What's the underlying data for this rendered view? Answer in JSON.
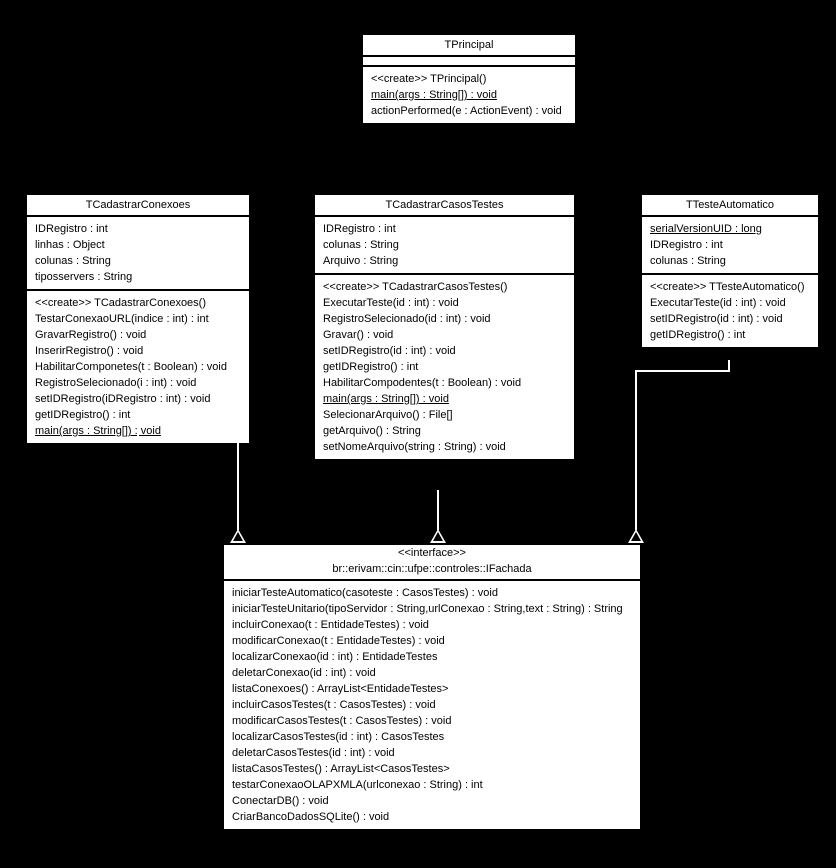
{
  "classes": {
    "tprincipal": {
      "name": "TPrincipal",
      "attrs": [],
      "methods": [
        {
          "text": "<<create>> TPrincipal()",
          "static": false
        },
        {
          "text": "main(args : String[]) : void",
          "static": true
        },
        {
          "text": "actionPerformed(e : ActionEvent) : void",
          "static": false
        }
      ]
    },
    "tcadconexoes": {
      "name": "TCadastrarConexoes",
      "attrs": [
        {
          "text": "IDRegistro : int"
        },
        {
          "text": "linhas : Object"
        },
        {
          "text": "colunas : String"
        },
        {
          "text": "tiposservers : String"
        }
      ],
      "methods": [
        {
          "text": "<<create>> TCadastrarConexoes()",
          "static": false
        },
        {
          "text": "TestarConexaoURL(indice : int) : int",
          "static": false
        },
        {
          "text": "GravarRegistro() : void",
          "static": false
        },
        {
          "text": "InserirRegistro() : void",
          "static": false
        },
        {
          "text": "HabilitarComponetes(t : Boolean) : void",
          "static": false
        },
        {
          "text": "RegistroSelecionado(i : int) : void",
          "static": false
        },
        {
          "text": "setIDRegistro(iDRegistro : int) : void",
          "static": false
        },
        {
          "text": "getIDRegistro() : int",
          "static": false
        },
        {
          "text": "main(args : String[]) : void",
          "static": true
        }
      ]
    },
    "tcadcasos": {
      "name": "TCadastrarCasosTestes",
      "attrs": [
        {
          "text": "IDRegistro : int"
        },
        {
          "text": "colunas : String"
        },
        {
          "text": "Arquivo : String"
        }
      ],
      "methods": [
        {
          "text": "<<create>> TCadastrarCasosTestes()",
          "static": false
        },
        {
          "text": "ExecutarTeste(id : int) : void",
          "static": false
        },
        {
          "text": "RegistroSelecionado(id : int) : void",
          "static": false
        },
        {
          "text": "Gravar() : void",
          "static": false
        },
        {
          "text": "setIDRegistro(id : int) : void",
          "static": false
        },
        {
          "text": "getIDRegistro() : int",
          "static": false
        },
        {
          "text": "HabilitarCompodentes(t : Boolean) : void",
          "static": false
        },
        {
          "text": "main(args : String[]) : void",
          "static": true
        },
        {
          "text": "SelecionarArquivo() : File[]",
          "static": false
        },
        {
          "text": "getArquivo() : String",
          "static": false
        },
        {
          "text": "setNomeArquivo(string : String) : void",
          "static": false
        }
      ]
    },
    "tteste": {
      "name": "TTesteAutomatico",
      "attrs": [
        {
          "text": "serialVersionUID : long",
          "static": true
        },
        {
          "text": "IDRegistro : int"
        },
        {
          "text": "colunas : String"
        }
      ],
      "methods": [
        {
          "text": "<<create>> TTesteAutomatico()",
          "static": false
        },
        {
          "text": "ExecutarTeste(id : int) : void",
          "static": false
        },
        {
          "text": "setIDRegistro(id : int) : void",
          "static": false
        },
        {
          "text": "getIDRegistro() : int",
          "static": false
        }
      ]
    },
    "ifachada": {
      "stereotype": "<<interface>>",
      "name": "br::erivam::cin::ufpe::controles::IFachada",
      "attrs": [],
      "methods": [
        {
          "text": "iniciarTesteAutomatico(casoteste : CasosTestes) : void"
        },
        {
          "text": "iniciarTesteUnitario(tipoServidor : String,urlConexao : String,text : String) : String"
        },
        {
          "text": "incluirConexao(t : EntidadeTestes) : void"
        },
        {
          "text": "modificarConexao(t : EntidadeTestes) : void"
        },
        {
          "text": "localizarConexao(id : int) : EntidadeTestes"
        },
        {
          "text": "deletarConexao(id : int) : void"
        },
        {
          "text": "listaConexoes() : ArrayList<EntidadeTestes>"
        },
        {
          "text": "incluirCasosTestes(t : CasosTestes) : void"
        },
        {
          "text": "modificarCasosTestes(t : CasosTestes) : void"
        },
        {
          "text": "localizarCasosTestes(id : int) : CasosTestes"
        },
        {
          "text": "deletarCasosTestes(id : int) : void"
        },
        {
          "text": "listaCasosTestes() : ArrayList<CasosTestes>"
        },
        {
          "text": "testarConexaoOLAPXMLA(urlconexao : String) : int"
        },
        {
          "text": "ConectarDB() : void"
        },
        {
          "text": "CriarBancoDadosSQLite() : void"
        }
      ]
    }
  }
}
